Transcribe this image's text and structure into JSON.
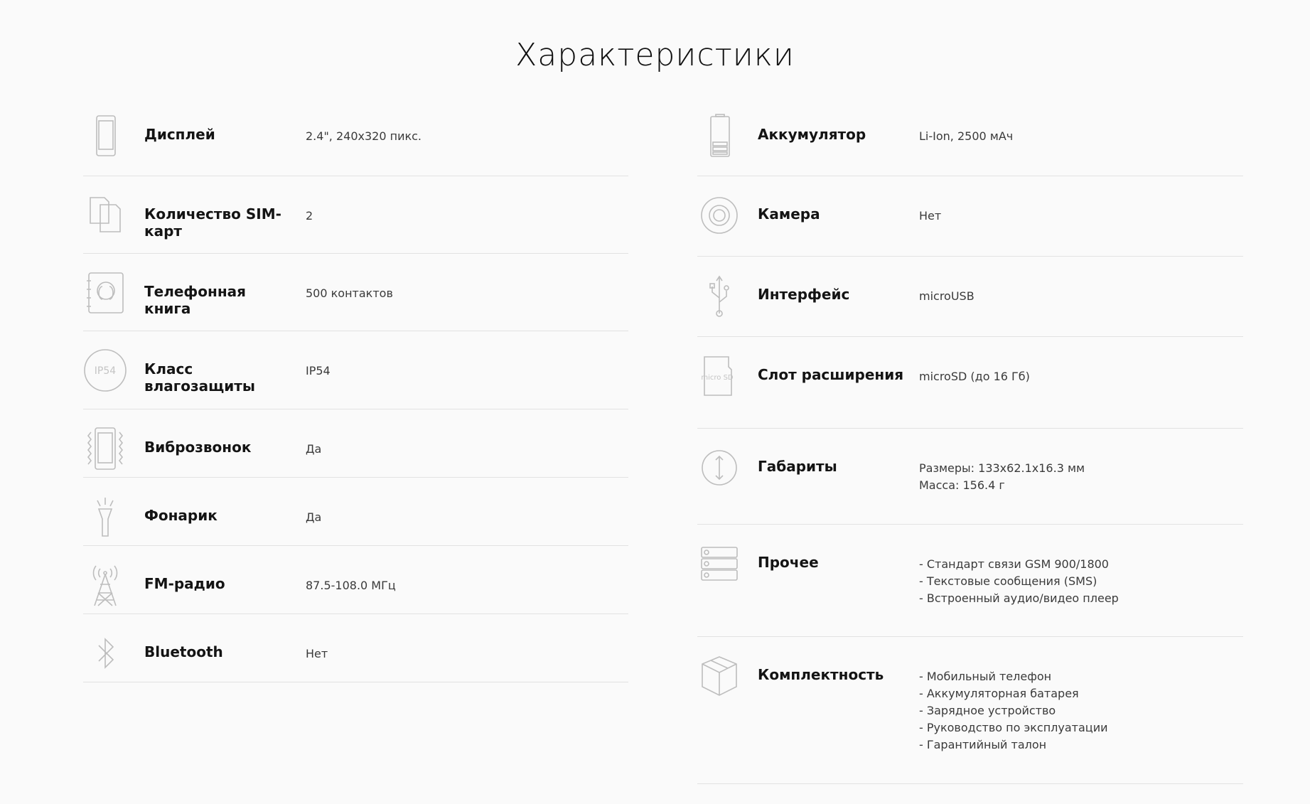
{
  "page": {
    "title": "Характеристики"
  },
  "left": [
    {
      "icon": "display-icon",
      "label": "Дисплей",
      "value": [
        "2.4\", 240x320 пикс."
      ]
    },
    {
      "icon": "sim-cards-icon",
      "label": "Количество SIM-карт",
      "value": [
        "2"
      ]
    },
    {
      "icon": "phonebook-icon",
      "label": "Телефонная книга",
      "value": [
        "500 контактов"
      ]
    },
    {
      "icon": "ip54-icon",
      "icon_text": "IP54",
      "label": "Класс влагозащиты",
      "value": [
        "IP54"
      ]
    },
    {
      "icon": "vibration-icon",
      "label": "Виброзвонок",
      "value": [
        "Да"
      ]
    },
    {
      "icon": "flashlight-icon",
      "label": "Фонарик",
      "value": [
        "Да"
      ]
    },
    {
      "icon": "radio-tower-icon",
      "label": "FM-радио",
      "value": [
        "87.5-108.0 МГц"
      ]
    },
    {
      "icon": "bluetooth-icon",
      "label": "Bluetooth",
      "value": [
        "Нет"
      ]
    }
  ],
  "right": [
    {
      "icon": "battery-icon",
      "label": "Аккумулятор",
      "value": [
        "Li-Ion, 2500 мАч"
      ]
    },
    {
      "icon": "camera-icon",
      "label": "Камера",
      "value": [
        "Нет"
      ]
    },
    {
      "icon": "usb-icon",
      "label": "Интерфейс",
      "value": [
        "microUSB"
      ]
    },
    {
      "icon": "microsd-icon",
      "icon_text": "micro SD",
      "label": "Слот расширения",
      "value": [
        "microSD (до 16 Гб)"
      ]
    },
    {
      "icon": "dimensions-icon",
      "label": "Габариты",
      "value": [
        "Размеры: 133x62.1x16.3 мм",
        "Масса: 156.4 г"
      ]
    },
    {
      "icon": "list-icon",
      "label": "Прочее",
      "value": [
        "- Стандарт связи GSM 900/1800",
        "- Текстовые сообщения (SMS)",
        "- Встроенный аудио/видео плеер"
      ]
    },
    {
      "icon": "box-icon",
      "label": "Комплектность",
      "value": [
        "- Мобильный телефон",
        "- Аккумуляторная батарея",
        "- Зарядное устройство",
        "- Руководство по эксплуатации",
        "- Гарантийный талон"
      ]
    }
  ]
}
